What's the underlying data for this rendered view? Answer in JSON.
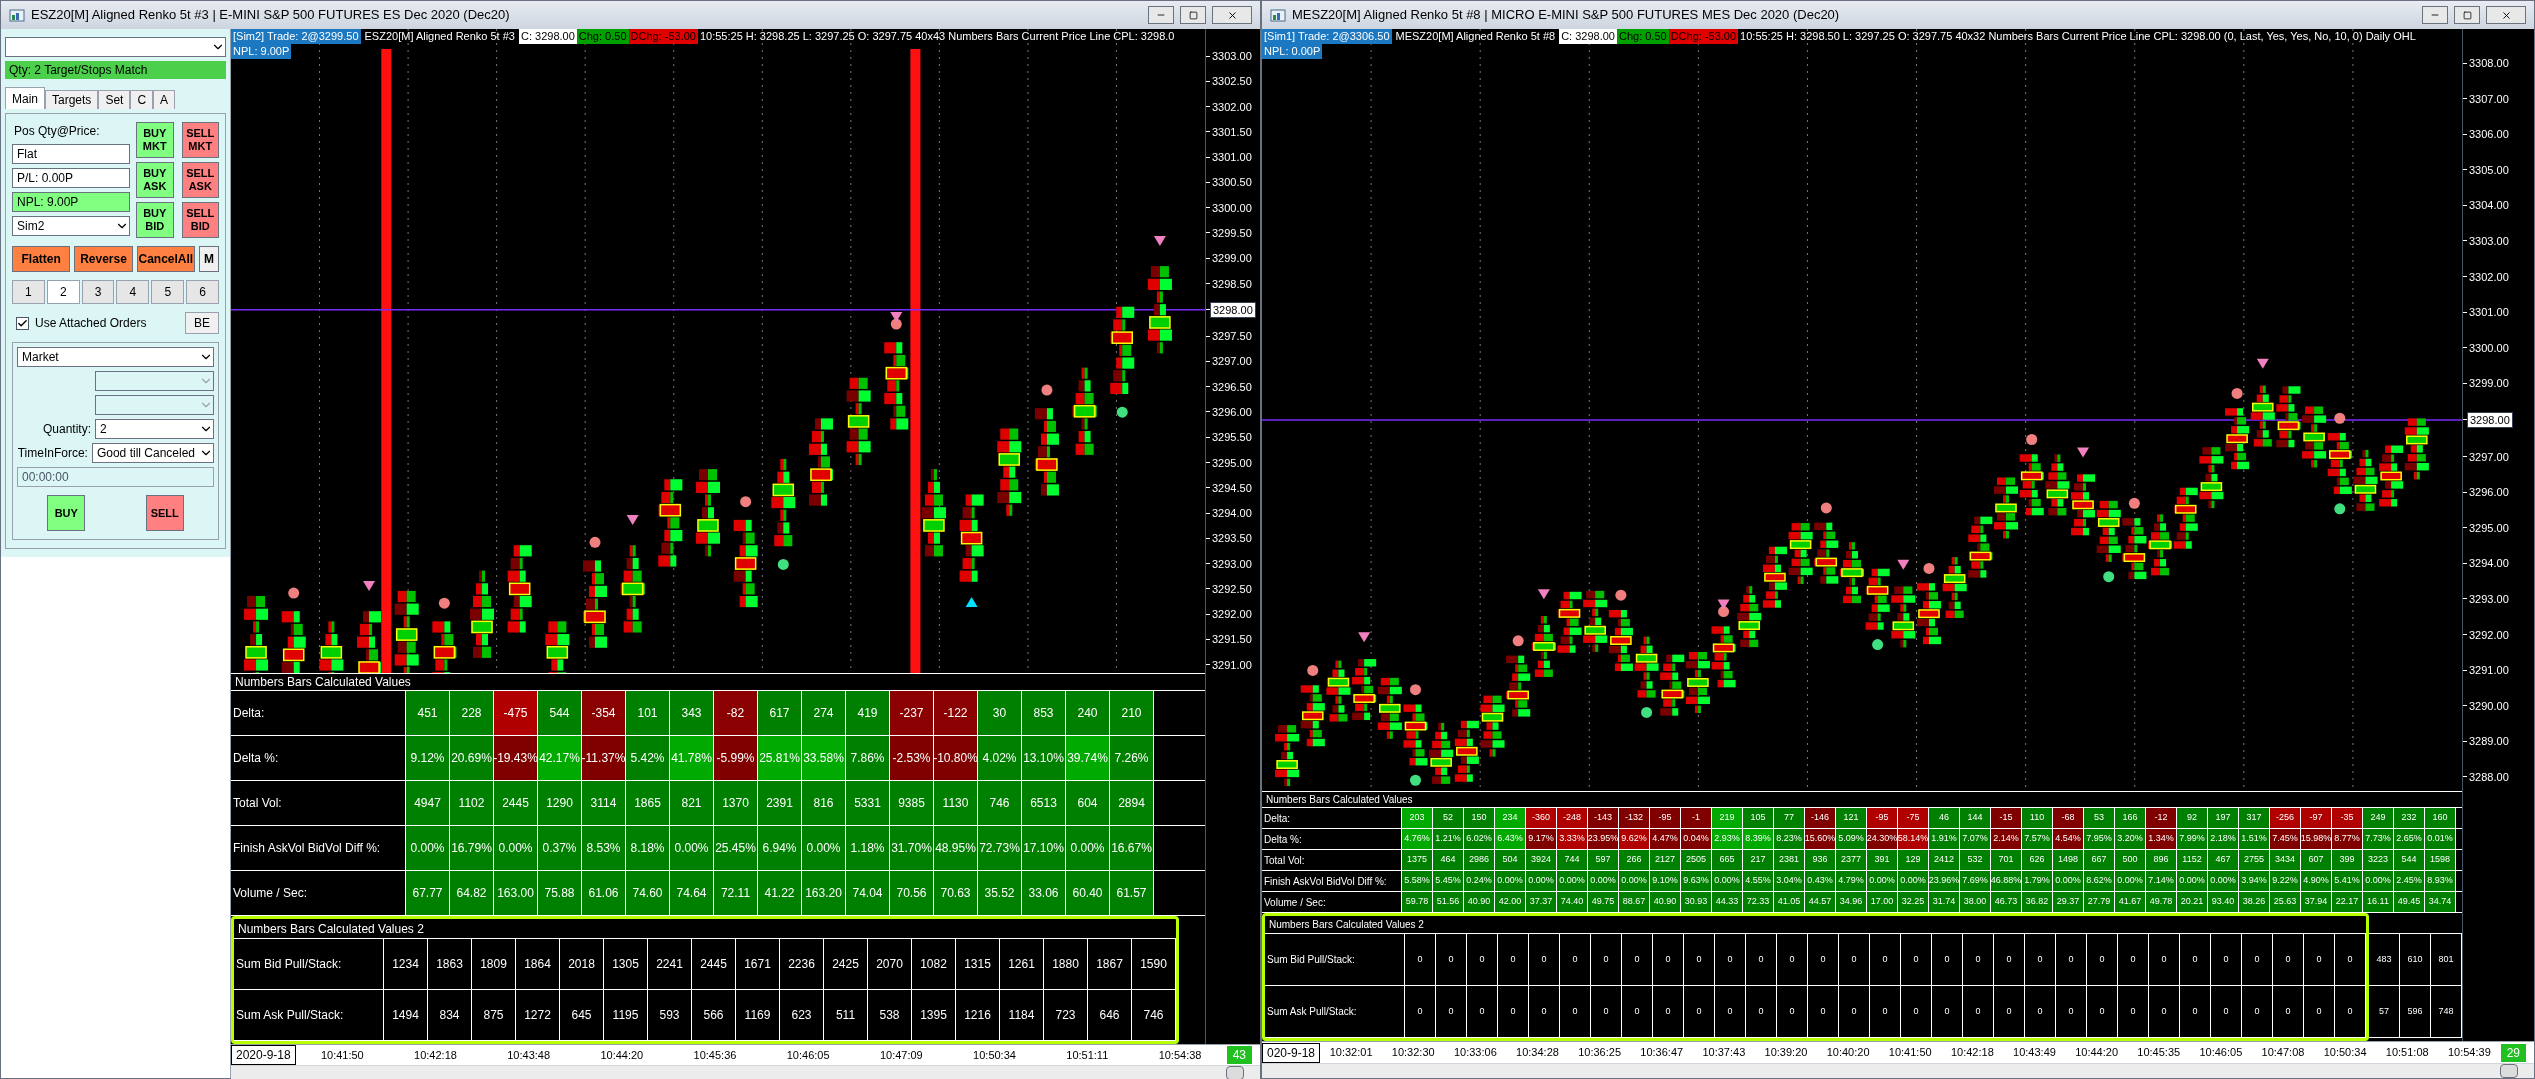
{
  "windows": [
    {
      "title": "ESZ20[M]  Aligned Renko 5t  #3 | E-MINI S&P 500 FUTURES ES Dec 2020 (Dec20)",
      "order_panel": {
        "status": "Qty: 2 Target/Stops Match",
        "tabs": [
          {
            "label": "Main",
            "selected": true
          },
          {
            "label": "Targets",
            "selected": false
          },
          {
            "label": "Set",
            "selected": false
          },
          {
            "label": "C",
            "selected": false
          },
          {
            "label": "A",
            "selected": false
          }
        ],
        "position_label": "Pos Qty@Price:",
        "fields": [
          {
            "value": "Flat",
            "highlighted": false
          },
          {
            "value": "P/L: 0.00P",
            "highlighted": false
          },
          {
            "value": "NPL: 9.00P",
            "highlighted": true
          }
        ],
        "account": "Sim2",
        "quick_buttons": [
          {
            "label": "BUY MKT",
            "kind": "buy"
          },
          {
            "label": "SELL MKT",
            "kind": "sell"
          },
          {
            "label": "BUY ASK",
            "kind": "buy"
          },
          {
            "label": "SELL ASK",
            "kind": "sell"
          },
          {
            "label": "BUY BID",
            "kind": "buy"
          },
          {
            "label": "SELL BID",
            "kind": "sell"
          }
        ],
        "action_buttons": [
          {
            "label": "Flatten",
            "kind": "action"
          },
          {
            "label": "Reverse",
            "kind": "action"
          },
          {
            "label": "CancelAll",
            "kind": "action"
          },
          {
            "label": "M",
            "kind": "plain"
          }
        ],
        "quantity_presets": [
          {
            "label": "1",
            "selected": false
          },
          {
            "label": "2",
            "selected": true
          },
          {
            "label": "3",
            "selected": false
          },
          {
            "label": "4",
            "selected": false
          },
          {
            "label": "5",
            "selected": false
          },
          {
            "label": "6",
            "selected": false
          }
        ],
        "attached_orders": {
          "label": "Use Attached Orders",
          "checked": true
        },
        "be_button": "BE",
        "order_type": "Market",
        "extra_dropdowns": [
          {
            "disabled": true
          },
          {
            "disabled": true
          }
        ],
        "quantity_label": "Quantity:",
        "quantity": "2",
        "tif_label": "TimeInForce:",
        "tif": "Good till Canceled",
        "time": {
          "value": "00:00:00",
          "disabled": true
        },
        "submit_buttons": [
          {
            "label": "BUY",
            "kind": "buy"
          },
          {
            "label": "SELL",
            "kind": "sell"
          }
        ]
      },
      "header": {
        "account": "[Sim2]  Trade: 2@3299.50",
        "instrument": "ESZ20[M]  Aligned Renko 5t  #3",
        "close": "C: 3298.00",
        "change": "Chg: 0.50",
        "day_change": "DChg: -53.00",
        "stats": "10:55:25 H: 3298.25 L: 3297.25 O: 3297.75 40x43 Numbers Bars  Current Price Line  CPL: 3298.0",
        "npl": "NPL: 9.00P"
      },
      "price_axis": [
        {
          "text": "3303.00",
          "highlighted": false
        },
        {
          "text": "3302.50",
          "highlighted": false
        },
        {
          "text": "3302.00",
          "highlighted": false
        },
        {
          "text": "3301.50",
          "highlighted": false
        },
        {
          "text": "3301.00",
          "highlighted": false
        },
        {
          "text": "3300.50",
          "highlighted": false
        },
        {
          "text": "3300.00",
          "highlighted": false
        },
        {
          "text": "3299.50",
          "highlighted": false
        },
        {
          "text": "3299.00",
          "highlighted": false
        },
        {
          "text": "3298.50",
          "highlighted": false
        },
        {
          "text": "3298.00",
          "highlighted": true
        },
        {
          "text": "3297.50",
          "highlighted": false
        },
        {
          "text": "3297.00",
          "highlighted": false
        },
        {
          "text": "3296.50",
          "highlighted": false
        },
        {
          "text": "3296.00",
          "highlighted": false
        },
        {
          "text": "3295.50",
          "highlighted": false
        },
        {
          "text": "3295.00",
          "highlighted": false
        },
        {
          "text": "3294.50",
          "highlighted": false
        },
        {
          "text": "3294.00",
          "highlighted": false
        },
        {
          "text": "3293.50",
          "highlighted": false
        },
        {
          "text": "3293.00",
          "highlighted": false
        },
        {
          "text": "3292.50",
          "highlighted": false
        },
        {
          "text": "3292.00",
          "highlighted": false
        },
        {
          "text": "3291.50",
          "highlighted": false
        },
        {
          "text": "3291.00",
          "highlighted": false
        }
      ],
      "table_1": {
        "title": "Numbers Bars Calculated Values",
        "rows": [
          {
            "label": "Delta:",
            "cells": [
              "451",
              "228",
              {
                "text": "-475",
                "color": "#b00000"
              },
              "544",
              {
                "text": "-354",
                "color": "#8b0000"
              },
              "101",
              "343",
              {
                "text": "-82",
                "color": "#8b0000"
              },
              "617",
              "274",
              "419",
              {
                "text": "-237",
                "color": "#8b0000"
              },
              {
                "text": "-122",
                "color": "#8b0000"
              },
              "30",
              "853",
              "240",
              "210"
            ]
          },
          {
            "label": "Delta %:",
            "cells": [
              "9.12%",
              "20.69%",
              {
                "text": "-19.43%",
                "color": "#800000"
              },
              {
                "text": "42.17%",
                "color": "#00aa00"
              },
              {
                "text": "-11.37%",
                "color": "#800000"
              },
              "5.42%",
              {
                "text": "41.78%",
                "color": "#00aa00"
              },
              {
                "text": "-5.99%",
                "color": "#800000"
              },
              {
                "text": "25.81%",
                "color": "#00aa00"
              },
              {
                "text": "33.58%",
                "color": "#00aa00"
              },
              "7.86%",
              {
                "text": "-2.53%",
                "color": "#800000"
              },
              {
                "text": "-10.80%",
                "color": "#800000"
              },
              "4.02%",
              "13.10%",
              {
                "text": "39.74%",
                "color": "#00aa00"
              },
              "7.26%"
            ]
          },
          {
            "label": "Total Vol:",
            "cells": [
              "4947",
              "1102",
              "2445",
              "1290",
              "3114",
              "1865",
              "821",
              "1370",
              "2391",
              "816",
              "5331",
              "9385",
              "1130",
              "746",
              "6513",
              "604",
              "2894"
            ]
          },
          {
            "label": "Finish AskVol BidVol Diff %:",
            "cells": [
              "0.00%",
              "16.79%",
              "0.00%",
              "0.37%",
              "8.53%",
              "8.18%",
              "0.00%",
              "25.45%",
              "6.94%",
              "0.00%",
              "1.18%",
              "31.70%",
              "48.95%",
              "72.73%",
              "17.10%",
              "0.00%",
              "16.67%"
            ]
          },
          {
            "label": "Volume / Sec:",
            "cells": [
              "67.77",
              "64.82",
              "163.00",
              "75.88",
              "61.06",
              "74.60",
              "74.64",
              "72.11",
              "41.22",
              "163.20",
              "74.04",
              "70.56",
              "70.63",
              "35.52",
              "33.06",
              "60.40",
              "61.57"
            ]
          }
        ]
      },
      "table_2": {
        "title": "Numbers Bars Calculated Values 2",
        "rows": [
          {
            "label": "Sum Bid Pull/Stack:",
            "cells": [
              "1234",
              "1863",
              "1809",
              "1864",
              "2018",
              "1305",
              "2241",
              "2445",
              "1671",
              "2236",
              "2425",
              "2070",
              "1082",
              "1315",
              "1261",
              "1880",
              "1867",
              "1590"
            ]
          },
          {
            "label": "Sum Ask Pull/Stack:",
            "cells": [
              "1494",
              "834",
              "875",
              "1272",
              "645",
              "1195",
              "593",
              "566",
              "1169",
              "623",
              "511",
              "538",
              "1395",
              "1216",
              "1184",
              "723",
              "646",
              "746"
            ]
          }
        ]
      },
      "time_axis": {
        "date": "2020-9-18",
        "times": [
          "10:41:50",
          "10:42:18",
          "10:43:48",
          "10:44:20",
          "10:45:36",
          "10:46:05",
          "10:47:09",
          "10:50:34",
          "10:51:11",
          "10:54:38"
        ],
        "bar_count": "43"
      }
    },
    {
      "title": "MESZ20[M]  Aligned Renko 5t  #8 | MICRO E-MINI S&P 500 FUTURES MES Dec 2020 (Dec20)",
      "header": {
        "account": "[Sim1]  Trade: 2@3306.50",
        "instrument": "MESZ20[M]  Aligned Renko 5t  #8",
        "close": "C: 3298.00",
        "change": "Chg: 0.50",
        "day_change": "DChg: -53.00",
        "stats": "10:55:25 H: 3298.50 L: 3297.25 O: 3297.75 40x32 Numbers Bars  Current Price Line  CPL: 3298.00   (0, Last, Yes, Yes, No, 10, 0)  Daily OHL",
        "npl": "NPL: 0.00P"
      },
      "price_axis": [
        {
          "text": "3308.00",
          "highlighted": false
        },
        {
          "text": "3307.00",
          "highlighted": false
        },
        {
          "text": "3306.00",
          "highlighted": false
        },
        {
          "text": "3305.00",
          "highlighted": false
        },
        {
          "text": "3304.00",
          "highlighted": false
        },
        {
          "text": "3303.00",
          "highlighted": false
        },
        {
          "text": "3302.00",
          "highlighted": false
        },
        {
          "text": "3301.00",
          "highlighted": false
        },
        {
          "text": "3300.00",
          "highlighted": false
        },
        {
          "text": "3299.00",
          "highlighted": false
        },
        {
          "text": "3298.00",
          "highlighted": true
        },
        {
          "text": "3297.00",
          "highlighted": false
        },
        {
          "text": "3296.00",
          "highlighted": false
        },
        {
          "text": "3295.00",
          "highlighted": false
        },
        {
          "text": "3294.00",
          "highlighted": false
        },
        {
          "text": "3293.00",
          "highlighted": false
        },
        {
          "text": "3292.00",
          "highlighted": false
        },
        {
          "text": "3291.00",
          "highlighted": false
        },
        {
          "text": "3290.00",
          "highlighted": false
        },
        {
          "text": "3289.00",
          "highlighted": false
        },
        {
          "text": "3288.00",
          "highlighted": false
        }
      ],
      "table_1": {
        "title": "Numbers Bars Calculated Values",
        "rows": [
          {
            "label": "Delta:",
            "cells": [
              {
                "text": "203",
                "color": "#00aa00"
              },
              "52",
              "150",
              {
                "text": "234",
                "color": "#00aa00"
              },
              {
                "text": "-360",
                "color": "#b00000"
              },
              {
                "text": "-248",
                "color": "#b00000"
              },
              {
                "text": "-143",
                "color": "#800000"
              },
              {
                "text": "-132",
                "color": "#800000"
              },
              {
                "text": "-95",
                "color": "#800000"
              },
              {
                "text": "-1",
                "color": "#800000"
              },
              {
                "text": "219",
                "color": "#00aa00"
              },
              "105",
              "77",
              {
                "text": "-146",
                "color": "#800000"
              },
              "121",
              {
                "text": "-95",
                "color": "#b00000"
              },
              {
                "text": "-75",
                "color": "#b00000"
              },
              "46",
              "144",
              {
                "text": "-15",
                "color": "#800000"
              },
              "110",
              {
                "text": "-68",
                "color": "#800000"
              },
              "53",
              "166",
              {
                "text": "-12",
                "color": "#800000"
              },
              "92",
              "197",
              "317",
              {
                "text": "-256",
                "color": "#b00000"
              },
              {
                "text": "-97",
                "color": "#b00000"
              },
              {
                "text": "-35",
                "color": "#b00000"
              },
              "249",
              "232",
              "160"
            ]
          },
          {
            "label": "Delta %:",
            "cells": [
              {
                "text": "4.76%",
                "color": "#00aa00"
              },
              "1.21%",
              "6.02%",
              {
                "text": "6.43%",
                "color": "#00aa00"
              },
              {
                "text": "9.17%",
                "color": "#800000"
              },
              {
                "text": "3.33%",
                "color": "#b00000"
              },
              {
                "text": "23.95%",
                "color": "#800000"
              },
              {
                "text": "9.62%",
                "color": "#b00000"
              },
              {
                "text": "4.47%",
                "color": "#800000"
              },
              {
                "text": "0.04%",
                "color": "#800000"
              },
              {
                "text": "2.93%",
                "color": "#00aa00"
              },
              {
                "text": "8.39%",
                "color": "#00aa00"
              },
              "8.23%",
              {
                "text": "15.60%",
                "color": "#800000"
              },
              "5.09%",
              {
                "text": "24.30%",
                "color": "#800000"
              },
              {
                "text": "58.14%",
                "color": "#b00000"
              },
              "1.91%",
              "7.07%",
              {
                "text": "2.14%",
                "color": "#800000"
              },
              "7.57%",
              {
                "text": "4.54%",
                "color": "#800000"
              },
              "7.95%",
              "3.20%",
              {
                "text": "1.34%",
                "color": "#800000"
              },
              "7.99%",
              "2.18%",
              "1.51%",
              {
                "text": "7.45%",
                "color": "#800000"
              },
              {
                "text": "15.98%",
                "color": "#800000"
              },
              {
                "text": "8.77%",
                "color": "#800000"
              },
              "7.73%",
              "2.65%",
              "0.01%"
            ]
          },
          {
            "label": "Total Vol:",
            "cells": [
              "1375",
              "464",
              "2986",
              "504",
              "3924",
              "744",
              "597",
              "266",
              "2127",
              "2505",
              "665",
              "217",
              "2381",
              "936",
              "2377",
              "391",
              "129",
              "2412",
              "532",
              "701",
              "626",
              "1498",
              "667",
              "500",
              "896",
              "1152",
              "467",
              "2755",
              "3434",
              "607",
              "399",
              "3223",
              "544",
              "1598"
            ]
          },
          {
            "label": "Finish AskVol BidVol Diff %:",
            "cells": [
              "5.58%",
              "5.45%",
              "0.24%",
              "0.00%",
              "0.00%",
              "0.00%",
              "0.00%",
              "0.00%",
              "9.10%",
              "9.63%",
              "0.00%",
              "4.55%",
              "3.04%",
              "0.43%",
              "4.79%",
              "0.00%",
              "0.00%",
              "23.96%",
              "7.69%",
              "46.88%",
              "1.79%",
              "0.00%",
              "8.62%",
              "0.00%",
              "7.14%",
              "0.00%",
              "0.00%",
              "3.94%",
              "9.22%",
              "4.90%",
              "5.41%",
              "0.00%",
              "2.45%",
              "8.93%"
            ]
          },
          {
            "label": "Volume / Sec:",
            "cells": [
              "59.78",
              "51.56",
              "40.90",
              "42.00",
              "37.37",
              "74.40",
              "49.75",
              "88.67",
              "40.90",
              "30.93",
              "44.33",
              "72.33",
              "41.05",
              "44.57",
              "34.96",
              "17.00",
              "32.25",
              "31.74",
              "38.00",
              "46.73",
              "36.82",
              "29.37",
              "27.79",
              "41.67",
              "49.78",
              "20.21",
              "93.40",
              "38.26",
              "25.63",
              "37.94",
              "22.17",
              "16.11",
              "49.45",
              "34.74"
            ]
          }
        ]
      },
      "table_2": {
        "title": "Numbers Bars Calculated Values 2",
        "rows": [
          {
            "label": "Sum Bid Pull/Stack:",
            "cells": [
              "0",
              "0",
              "0",
              "0",
              "0",
              "0",
              "0",
              "0",
              "0",
              "0",
              "0",
              "0",
              "0",
              "0",
              "0",
              "0",
              "0",
              "0",
              "0",
              "0",
              "0",
              "0",
              "0",
              "0",
              "0",
              "0",
              "0",
              "0",
              "0",
              "0",
              "0"
            ],
            "extra_cells": [
              "483",
              "610",
              "801"
            ]
          },
          {
            "label": "Sum Ask Pull/Stack:",
            "cells": [
              "0",
              "0",
              "0",
              "0",
              "0",
              "0",
              "0",
              "0",
              "0",
              "0",
              "0",
              "0",
              "0",
              "0",
              "0",
              "0",
              "0",
              "0",
              "0",
              "0",
              "0",
              "0",
              "0",
              "0",
              "0",
              "0",
              "0",
              "0",
              "0",
              "0",
              "0"
            ],
            "extra_cells": [
              "57",
              "596",
              "748"
            ]
          }
        ]
      },
      "time_axis": {
        "date": "020-9-18",
        "times": [
          "10:32:01",
          "10:32:30",
          "10:33:06",
          "10:34:28",
          "10:36:25",
          "10:36:47",
          "10:37:43",
          "10:39:20",
          "10:40:20",
          "10:41:50",
          "10:42:18",
          "10:43:49",
          "10:44:20",
          "10:45:35",
          "10:46:05",
          "10:47:08",
          "10:50:34",
          "10:51:08",
          "10:54:39"
        ],
        "bar_count": "29"
      }
    }
  ]
}
